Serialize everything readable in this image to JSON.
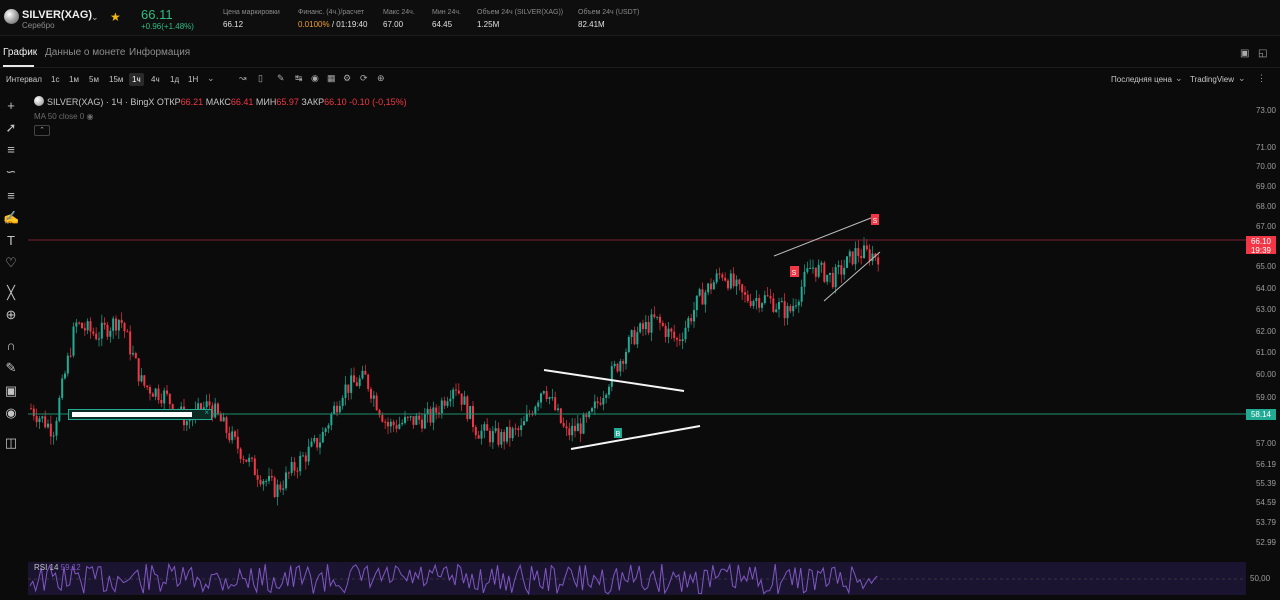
{
  "header": {
    "symbol": "SILVER(XAG)",
    "subtitle": "Серебро",
    "price": "66.11",
    "change": "+0.96(+1.48%)",
    "stats": [
      {
        "label": "Цена маркировки",
        "value": "66.12"
      },
      {
        "label": "Финанс. (4ч.)/расчет",
        "value_rate": "0.0100%",
        "value_time": " / 01:19:40"
      },
      {
        "label": "Макс 24ч.",
        "value": "67.00"
      },
      {
        "label": "Мин 24ч.",
        "value": "64.45"
      },
      {
        "label": "Объем 24ч (SILVER(XAG))",
        "value": "1.25M"
      },
      {
        "label": "Объем 24ч (USDT)",
        "value": "82.41M"
      }
    ]
  },
  "tabs": [
    "График",
    "Данные о монете",
    "Информация"
  ],
  "toolbar": {
    "interval_label": "Интервал",
    "intervals": [
      "1с",
      "1м",
      "5м",
      "15м",
      "1ч",
      "4ч",
      "1д",
      "1Н"
    ],
    "selected_interval": "1ч",
    "price_type": "Последняя цена",
    "view": "TradingView"
  },
  "legend": {
    "symbol": "SILVER(XAG)",
    "tf": "· 1Ч · BingX",
    "o_label": "ОТКР",
    "o": "66.21",
    "h_label": "МАКС",
    "h": "66.41",
    "l_label": "МИН",
    "l": "65.97",
    "c_label": "ЗАКР",
    "c": "66.10",
    "chg": "-0.10 (-0,15%)",
    "ma": "MA 50 close 0"
  },
  "yaxis_labels": [
    "73.00",
    "71.00",
    "70.00",
    "69.00",
    "68.00",
    "67.00",
    "65.00",
    "64.00",
    "63.00",
    "62.00",
    "61.00",
    "60.00",
    "59.00",
    "57.00",
    "56.19",
    "55.39",
    "54.59",
    "53.79",
    "52.99"
  ],
  "last_price_tag": {
    "price": "66.10",
    "countdown": "19:39",
    "color": "#f23645"
  },
  "alert_line_tag": {
    "price": "58.14",
    "color": "#22ab94"
  },
  "rsi": {
    "label": "RSI 14",
    "value": "59.12",
    "level": "50,00",
    "color": "#7e57c2"
  },
  "markers": {
    "buy": "B",
    "sell": "S"
  },
  "colors": {
    "up": "#22ab94",
    "down": "#f23645",
    "accent": "#f0b90b"
  },
  "chart_data": {
    "type": "candlestick",
    "ohlc_approx": [
      59.0,
      58.0,
      62.9,
      62.4,
      63.2,
      60.1,
      59.6,
      58.4,
      59.2,
      57.6,
      56.2,
      55.2,
      56.5,
      57.6,
      59.9,
      60.4,
      58.2,
      58.4,
      58.6,
      60.2,
      58.0,
      57.6,
      58.0,
      60.1,
      57.8,
      58.4,
      60.5,
      62.3,
      63.1,
      62.1,
      64.1,
      65.3,
      64.1,
      64.1,
      63.4,
      65.6,
      65.0,
      66.2,
      66.1
    ],
    "price_range": [
      52.99,
      73.0
    ]
  }
}
